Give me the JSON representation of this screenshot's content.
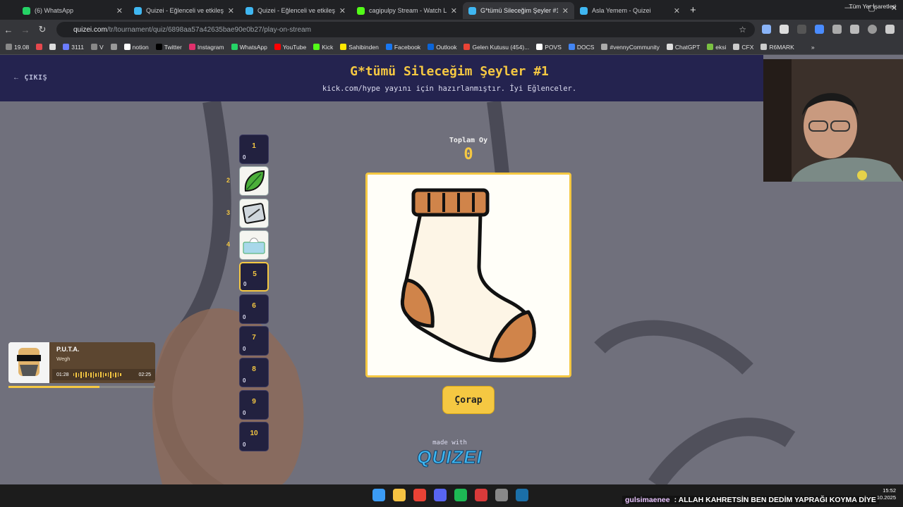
{
  "browser": {
    "tabs": [
      {
        "title": "(6) WhatsApp",
        "icon": "whatsapp-icon",
        "color": "#25d366",
        "active": false
      },
      {
        "title": "Quizei - Eğlenceli ve etkileşimli",
        "icon": "quizei-icon",
        "color": "#3fb7f2",
        "active": false
      },
      {
        "title": "Quizei - Eğlenceli ve etkileşimli",
        "icon": "quizei-icon",
        "color": "#3fb7f2",
        "active": false
      },
      {
        "title": "cagipulpy Stream - Watch Live",
        "icon": "kick-icon",
        "color": "#53fc18",
        "active": false
      },
      {
        "title": "G*tümü Sileceğim Şeyler #1 - Q",
        "icon": "quizei-icon",
        "color": "#3fb7f2",
        "active": true
      },
      {
        "title": "Asla Yemem - Quizei",
        "icon": "quizei-icon",
        "color": "#3fb7f2",
        "active": false
      }
    ],
    "url_host": "quizei.com",
    "url_path": "/tr/tournament/quiz/6898aa57a42635bae90e0b27/play-on-stream",
    "bookmarks": [
      {
        "label": "19.08",
        "color": "#888"
      },
      {
        "label": "",
        "color": "#e5484d"
      },
      {
        "label": "",
        "color": "#ddd"
      },
      {
        "label": "3111",
        "color": "#6b7cff"
      },
      {
        "label": "V",
        "color": "#888"
      },
      {
        "label": "",
        "color": "#999"
      },
      {
        "label": "notion",
        "color": "#ffffff"
      },
      {
        "label": "Twitter",
        "color": "#000000"
      },
      {
        "label": "Instagram",
        "color": "#e1306c"
      },
      {
        "label": "WhatsApp",
        "color": "#25d366"
      },
      {
        "label": "YouTube",
        "color": "#ff0000"
      },
      {
        "label": "Kick",
        "color": "#53fc18"
      },
      {
        "label": "Sahibinden",
        "color": "#ffe800"
      },
      {
        "label": "Facebook",
        "color": "#1877f2"
      },
      {
        "label": "Outlook",
        "color": "#0a64d8"
      },
      {
        "label": "Gelen Kutusu (454)...",
        "color": "#ea4335"
      },
      {
        "label": "POVS",
        "color": "#ffffff"
      },
      {
        "label": "DOCS",
        "color": "#4285f4"
      },
      {
        "label": "#vennyCommunity",
        "color": "#aaa"
      },
      {
        "label": "ChatGPT",
        "color": "#ddd"
      },
      {
        "label": "eksi",
        "color": "#7ac142"
      },
      {
        "label": "CFX",
        "color": "#ccc"
      },
      {
        "label": "R6MARK",
        "color": "#ccc"
      }
    ],
    "bookmarks_folder": "Tüm Yer İşaretleri"
  },
  "page": {
    "exit_label": "ÇIKIŞ",
    "title": "G*tümü Sileceğim Şeyler #1",
    "subtitle": "kick.com/hype yayını için hazırlanmıştır. İyi Eğlenceler.",
    "votes_label": "Toplam Oy",
    "votes_value": "0",
    "answer_label": "Çorap",
    "made_with": "made with",
    "logo_text": "QUIZEI",
    "accent_color": "#f5c842"
  },
  "slots": [
    {
      "rank": "1",
      "votes": "0",
      "image": null
    },
    {
      "rank": "2",
      "votes": "",
      "image": "leaf-icon"
    },
    {
      "rank": "3",
      "votes": "",
      "image": "device-icon"
    },
    {
      "rank": "4",
      "votes": "",
      "image": "tissue-box-icon"
    },
    {
      "rank": "5",
      "votes": "0",
      "image": null,
      "selected": true
    },
    {
      "rank": "6",
      "votes": "0",
      "image": null
    },
    {
      "rank": "7",
      "votes": "0",
      "image": null
    },
    {
      "rank": "8",
      "votes": "0",
      "image": null
    },
    {
      "rank": "9",
      "votes": "0",
      "image": null
    },
    {
      "rank": "10",
      "votes": "0",
      "image": null
    }
  ],
  "music": {
    "title": "P.U.T.A.",
    "artist": "Wegh",
    "elapsed": "01:28",
    "total": "02:25",
    "progress_fraction": 0.62
  },
  "chat": {
    "user": "gulsimaenee",
    "message": ": ALLAH KAHRETSİN BEN DEDİM YAPRAĞI KOYMA DİYE"
  },
  "clock": {
    "time": "15:52",
    "date": "10.2025"
  },
  "taskbar": [
    {
      "icon": "windows-start-icon",
      "color": "#3b9bf5"
    },
    {
      "icon": "file-explorer-icon",
      "color": "#f5c242"
    },
    {
      "icon": "chrome-icon",
      "color": "#e94235"
    },
    {
      "icon": "discord-icon",
      "color": "#5865f2"
    },
    {
      "icon": "spotify-icon",
      "color": "#1db954"
    },
    {
      "icon": "streaming-app-icon",
      "color": "#d93a3a"
    },
    {
      "icon": "settings-icon",
      "color": "#888888"
    },
    {
      "icon": "steam-icon",
      "color": "#1b6fa8"
    }
  ]
}
